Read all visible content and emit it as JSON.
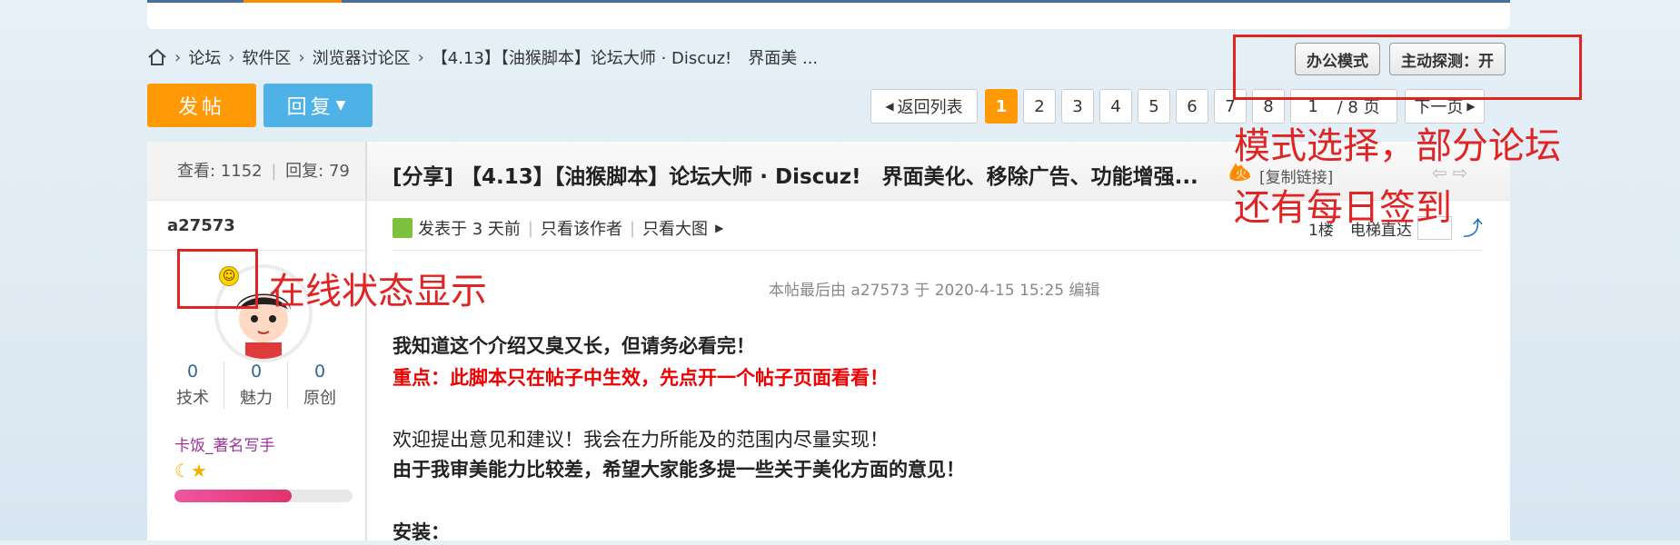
{
  "breadcrumb": {
    "items": [
      "论坛",
      "软件区",
      "浏览器讨论区",
      "【4.13】【油猴脚本】论坛大师 · Discuz!　界面美 ..."
    ]
  },
  "header_buttons": {
    "office_mode": "办公模式",
    "active_probe": "主动探测：开"
  },
  "actions": {
    "post": "发帖",
    "reply": "回复"
  },
  "pager": {
    "back": "返回列表",
    "pages": [
      "1",
      "2",
      "3",
      "4",
      "5",
      "6",
      "7",
      "8"
    ],
    "current": "1",
    "input_value": "1",
    "total": "/ 8 页",
    "next": "下一页"
  },
  "thread": {
    "stats": "查看: 1152",
    "replies": "回复: 79",
    "title": "[分享] 【4.13】【油猴脚本】论坛大师 · Discuz!　界面美化、移除广告、功能增强...",
    "copy_link": "[复制链接]"
  },
  "author": {
    "username": "a27573",
    "counts": [
      {
        "value": "0",
        "label": "技术"
      },
      {
        "value": "0",
        "label": "魅力"
      },
      {
        "value": "0",
        "label": "原创"
      }
    ],
    "rank": "卡饭_著名写手",
    "progress": 0.66
  },
  "post_meta": {
    "posted": "发表于 3 天前",
    "only_author": "只看该作者",
    "only_big_pic": "只看大图",
    "floor": "1楼",
    "elevator": "电梯直达"
  },
  "post": {
    "edit_note": "本帖最后由 a27573 于 2020-4-15 15:25 编辑",
    "line1": "我知道这个介绍又臭又长，但请务必看完！",
    "line2": "重点：此脚本只在帖子中生效，先点开一个帖子页面看看！",
    "line3": "欢迎提出意见和建议！我会在力所能及的范围内尽量实现！",
    "line4": "由于我审美能力比较差，希望大家能多提一些关于美化方面的意见！",
    "line5": "安装："
  },
  "annotations": {
    "mode_note_1": "模式选择，部分论坛",
    "mode_note_2": "还有每日签到",
    "online_note": "在线状态显示"
  },
  "colors": {
    "accent_orange": "#ff9a06",
    "reply_blue": "#4fb2e6",
    "annotation_red": "#e02424"
  }
}
